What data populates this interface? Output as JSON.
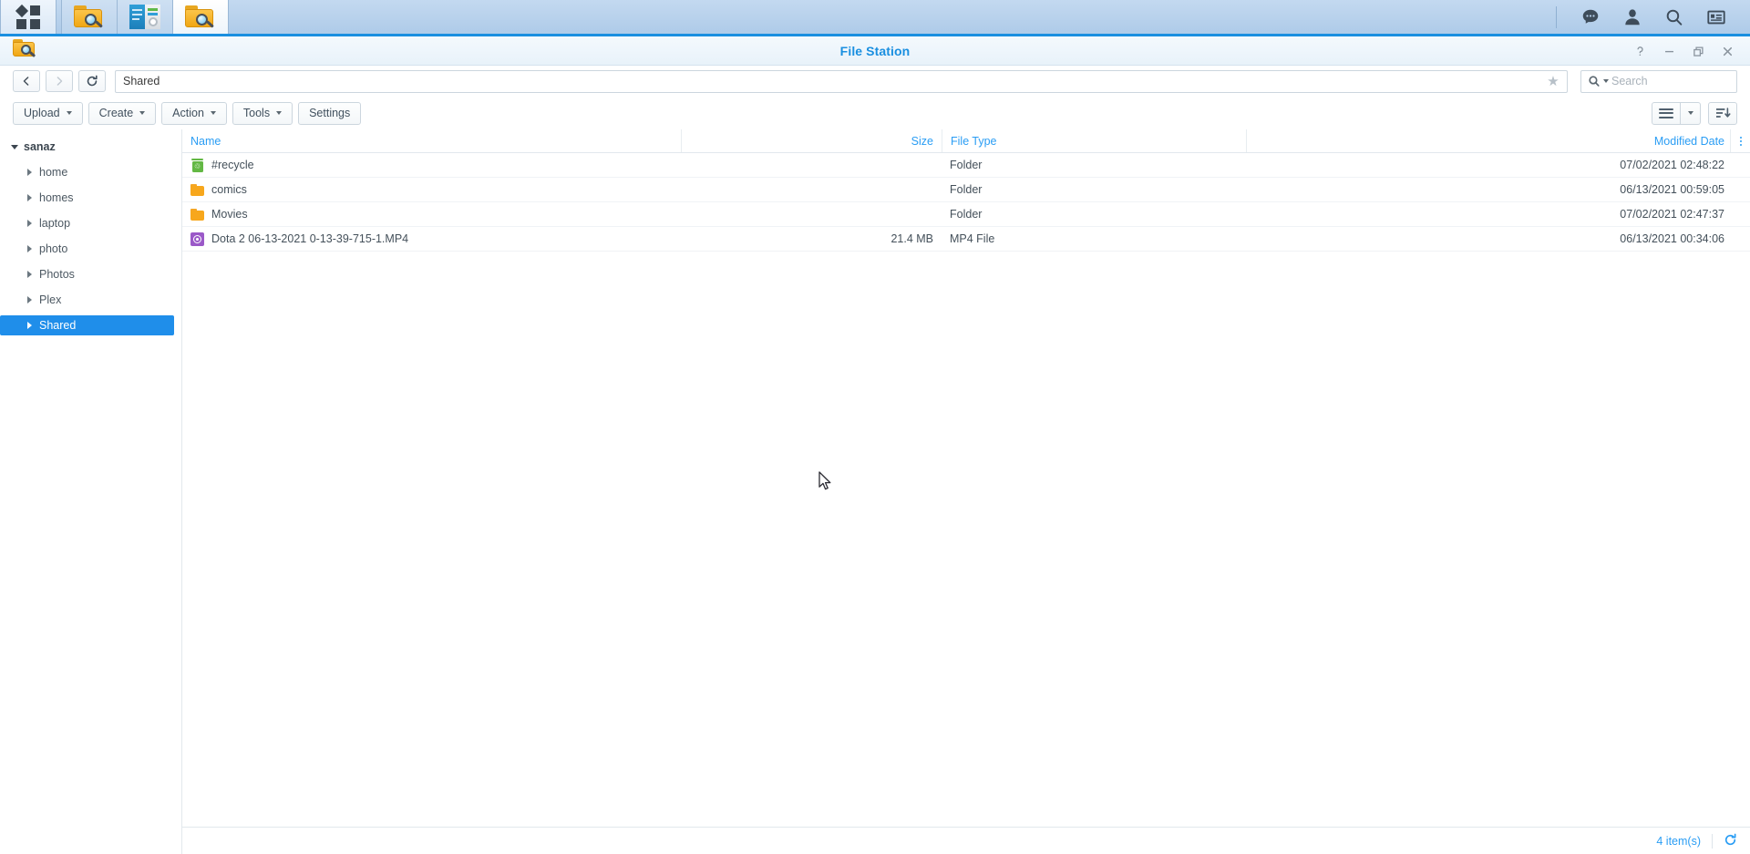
{
  "taskbar": {
    "main_menu_label": "main-menu",
    "items": [
      {
        "name": "file-station-1",
        "icon": "folder-search-icon",
        "active": false
      },
      {
        "name": "control-panel",
        "icon": "control-panel-icon",
        "active": false
      },
      {
        "name": "file-station-2",
        "icon": "folder-search-icon",
        "active": true
      }
    ],
    "right_icons": [
      {
        "name": "notifications-icon",
        "label": "notifications"
      },
      {
        "name": "user-icon",
        "label": "user"
      },
      {
        "name": "search-icon",
        "label": "search"
      },
      {
        "name": "widgets-icon",
        "label": "widgets"
      }
    ]
  },
  "window": {
    "title": "File Station",
    "icon": "folder-search-icon",
    "controls": [
      {
        "name": "help-button",
        "glyph": "?"
      },
      {
        "name": "minimize-button",
        "glyph": "—"
      },
      {
        "name": "restore-button",
        "glyph": "❐"
      },
      {
        "name": "close-button",
        "glyph": "✕"
      }
    ]
  },
  "nav": {
    "back_label": "Back",
    "forward_label": "Forward",
    "refresh_label": "Refresh",
    "path_value": "Shared",
    "favorite_icon": "star-icon"
  },
  "search": {
    "placeholder": "Search",
    "icon": "search-icon"
  },
  "toolbar": {
    "buttons": [
      {
        "label": "Upload",
        "has_menu": true
      },
      {
        "label": "Create",
        "has_menu": true
      },
      {
        "label": "Action",
        "has_menu": true
      },
      {
        "label": "Tools",
        "has_menu": true
      },
      {
        "label": "Settings",
        "has_menu": false
      }
    ],
    "view_button": "list-view-button",
    "view_menu": "list-view-dropdown",
    "sort_button": "sort-button"
  },
  "sidebar": {
    "root": {
      "label": "sanaz",
      "expanded": true
    },
    "items": [
      {
        "label": "home",
        "selected": false
      },
      {
        "label": "homes",
        "selected": false
      },
      {
        "label": "laptop",
        "selected": false
      },
      {
        "label": "photo",
        "selected": false
      },
      {
        "label": "Photos",
        "selected": false
      },
      {
        "label": "Plex",
        "selected": false
      },
      {
        "label": "Shared",
        "selected": true
      }
    ]
  },
  "file_list": {
    "columns": {
      "name": "Name",
      "size": "Size",
      "type": "File Type",
      "date": "Modified Date"
    },
    "rows": [
      {
        "name": "#recycle",
        "icon": "recycle-bin-icon",
        "size": "",
        "type": "Folder",
        "date": "07/02/2021 02:48:22"
      },
      {
        "name": "comics",
        "icon": "folder-icon",
        "size": "",
        "type": "Folder",
        "date": "06/13/2021 00:59:05"
      },
      {
        "name": "Movies",
        "icon": "folder-icon",
        "size": "",
        "type": "Folder",
        "date": "07/02/2021 02:47:37"
      },
      {
        "name": "Dota 2 06-13-2021 0-13-39-715-1.MP4",
        "icon": "media-file-icon",
        "size": "21.4 MB",
        "type": "MP4 File",
        "date": "06/13/2021 00:34:06"
      }
    ]
  },
  "status": {
    "item_count": "4 item(s)",
    "refresh_icon": "refresh-icon"
  },
  "colors": {
    "accent": "#2a9df4",
    "selection": "#1f8eea",
    "taskbar": "#b9d2ec",
    "folder": "#f7a71c",
    "recycle": "#63b844",
    "media": "#9b59c8"
  }
}
